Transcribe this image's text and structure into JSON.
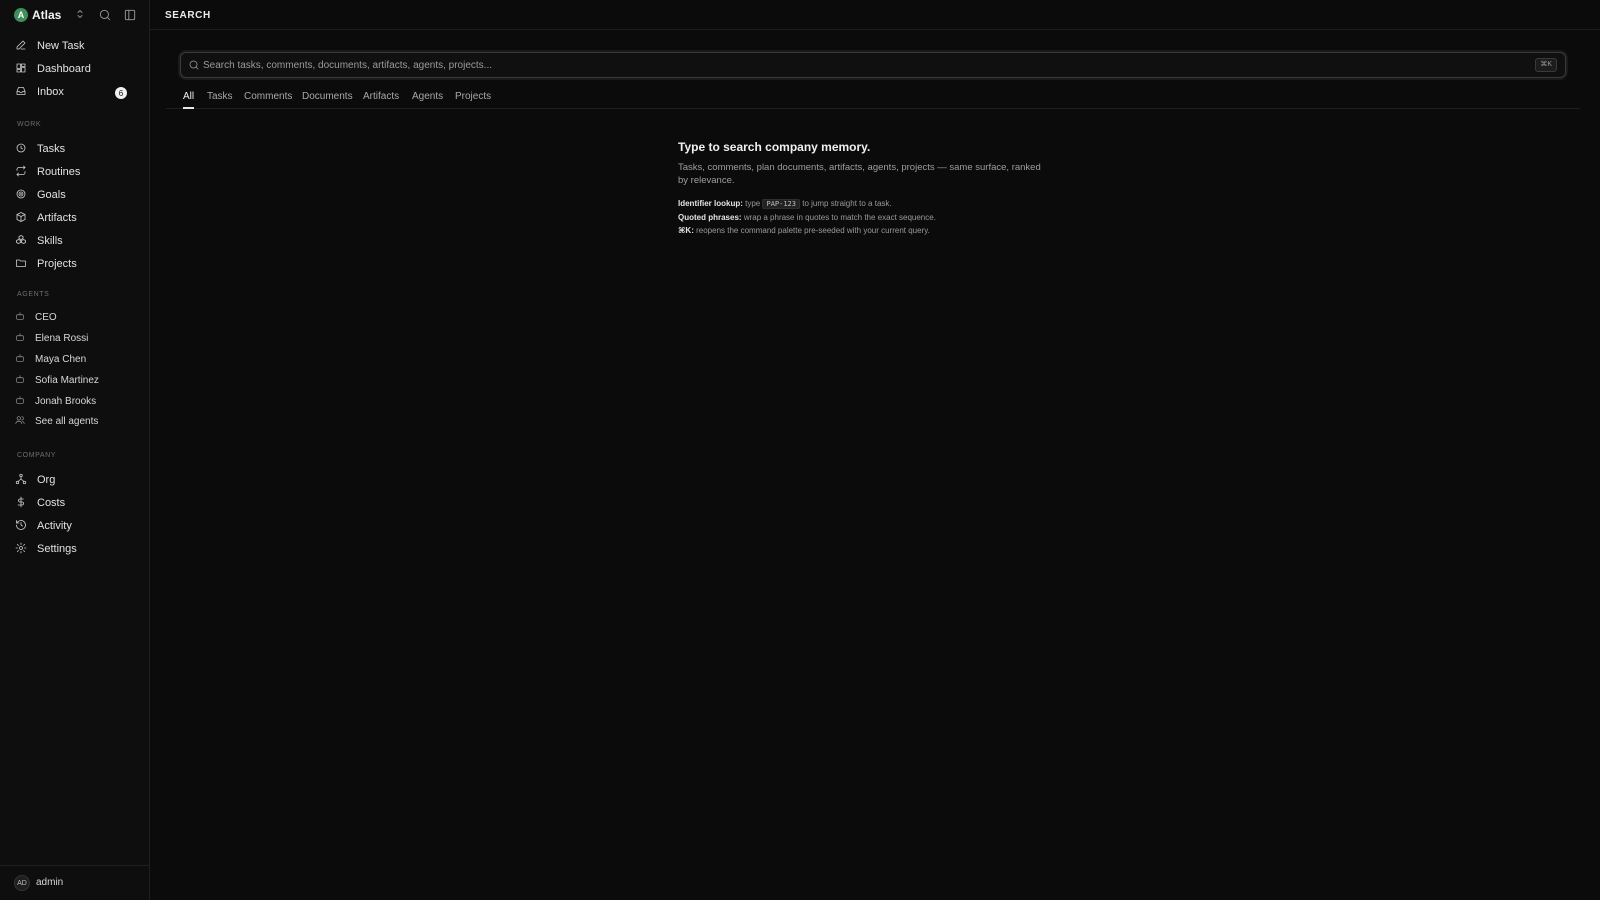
{
  "workspace": {
    "logo_letter": "A",
    "name": "Atlas"
  },
  "sidebar": {
    "primary": [
      {
        "label": "New Task",
        "icon": "edit-icon"
      },
      {
        "label": "Dashboard",
        "icon": "dashboard-icon"
      },
      {
        "label": "Inbox",
        "icon": "inbox-icon",
        "badge": "6"
      }
    ],
    "work_label": "WORK",
    "work": [
      {
        "label": "Tasks",
        "icon": "circle-icon"
      },
      {
        "label": "Routines",
        "icon": "repeat-icon"
      },
      {
        "label": "Goals",
        "icon": "target-icon"
      },
      {
        "label": "Artifacts",
        "icon": "box-icon"
      },
      {
        "label": "Skills",
        "icon": "boxes-icon"
      },
      {
        "label": "Projects",
        "icon": "folder-icon"
      }
    ],
    "agents_label": "AGENTS",
    "agents": [
      {
        "label": "CEO"
      },
      {
        "label": "Elena Rossi"
      },
      {
        "label": "Maya Chen"
      },
      {
        "label": "Sofia Martinez"
      },
      {
        "label": "Jonah Brooks"
      },
      {
        "label": "See all agents"
      }
    ],
    "company_label": "COMPANY",
    "company": [
      {
        "label": "Org",
        "icon": "org-icon"
      },
      {
        "label": "Costs",
        "icon": "dollar-icon"
      },
      {
        "label": "Activity",
        "icon": "history-icon"
      },
      {
        "label": "Settings",
        "icon": "gear-icon"
      }
    ],
    "user": {
      "initials": "AD",
      "name": "admin"
    }
  },
  "header": {
    "title": "SEARCH"
  },
  "search": {
    "placeholder": "Search tasks, comments, documents, artifacts, agents, projects...",
    "shortcut": "⌘K"
  },
  "tabs": [
    "All",
    "Tasks",
    "Comments",
    "Documents",
    "Artifacts",
    "Agents",
    "Projects"
  ],
  "empty_state": {
    "title": "Type to search company memory.",
    "description": "Tasks, comments, plan documents, artifacts, agents, projects — same surface, ranked by relevance.",
    "tip1_label": "Identifier lookup:",
    "tip1_pre": "type",
    "tip1_code": "PAP-123",
    "tip1_post": "to jump straight to a task.",
    "tip2_label": "Quoted phrases:",
    "tip2_text": "wrap a phrase in quotes to match the exact sequence.",
    "tip3_label": "⌘K:",
    "tip3_text": "reopens the command palette pre-seeded with your current query."
  }
}
